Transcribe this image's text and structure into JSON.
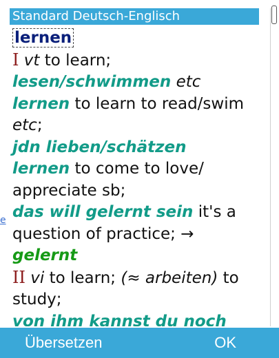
{
  "header": {
    "title": "Standard Deutsch-Englisch"
  },
  "entry": {
    "headword": "lernen",
    "sense1": {
      "num": "I",
      "pos": "vt",
      "gloss": " to learn;",
      "ex1_german": "lesen/schwimmen",
      "ex1_etc": " etc",
      "ex1_lernen": "lernen",
      "ex1_english": " to learn to read/swim",
      "ex1_etc2": "etc",
      "ex1_tail": ";",
      "ex2_german": "jdn lieben/schätzen",
      "ex2_lernen": "lernen",
      "ex2_english": " to come to love/",
      "ex2_english2": "appreciate sb;",
      "ex3_german": "das will gelernt sein",
      "ex3_english": " it's a",
      "ex3_english2": "question of practice; →",
      "ex3_ref": "gelernt"
    },
    "sense2": {
      "num": "II",
      "pos": "vi",
      "gloss": " to learn; ",
      "label": "(≈ arbeiten)",
      "gloss2": " to",
      "gloss3": "study;",
      "ex1_partial": "von ihm kannst du noch"
    }
  },
  "edge_fragment": "e",
  "softkeys": {
    "left": "Übersetzen",
    "right": "OK"
  },
  "colors": {
    "accent": "#3aa8d8",
    "headword": "#0a1f7a",
    "example": "#129b88",
    "cross_ref": "#169a16",
    "sense_number": "#8b1a1a"
  }
}
